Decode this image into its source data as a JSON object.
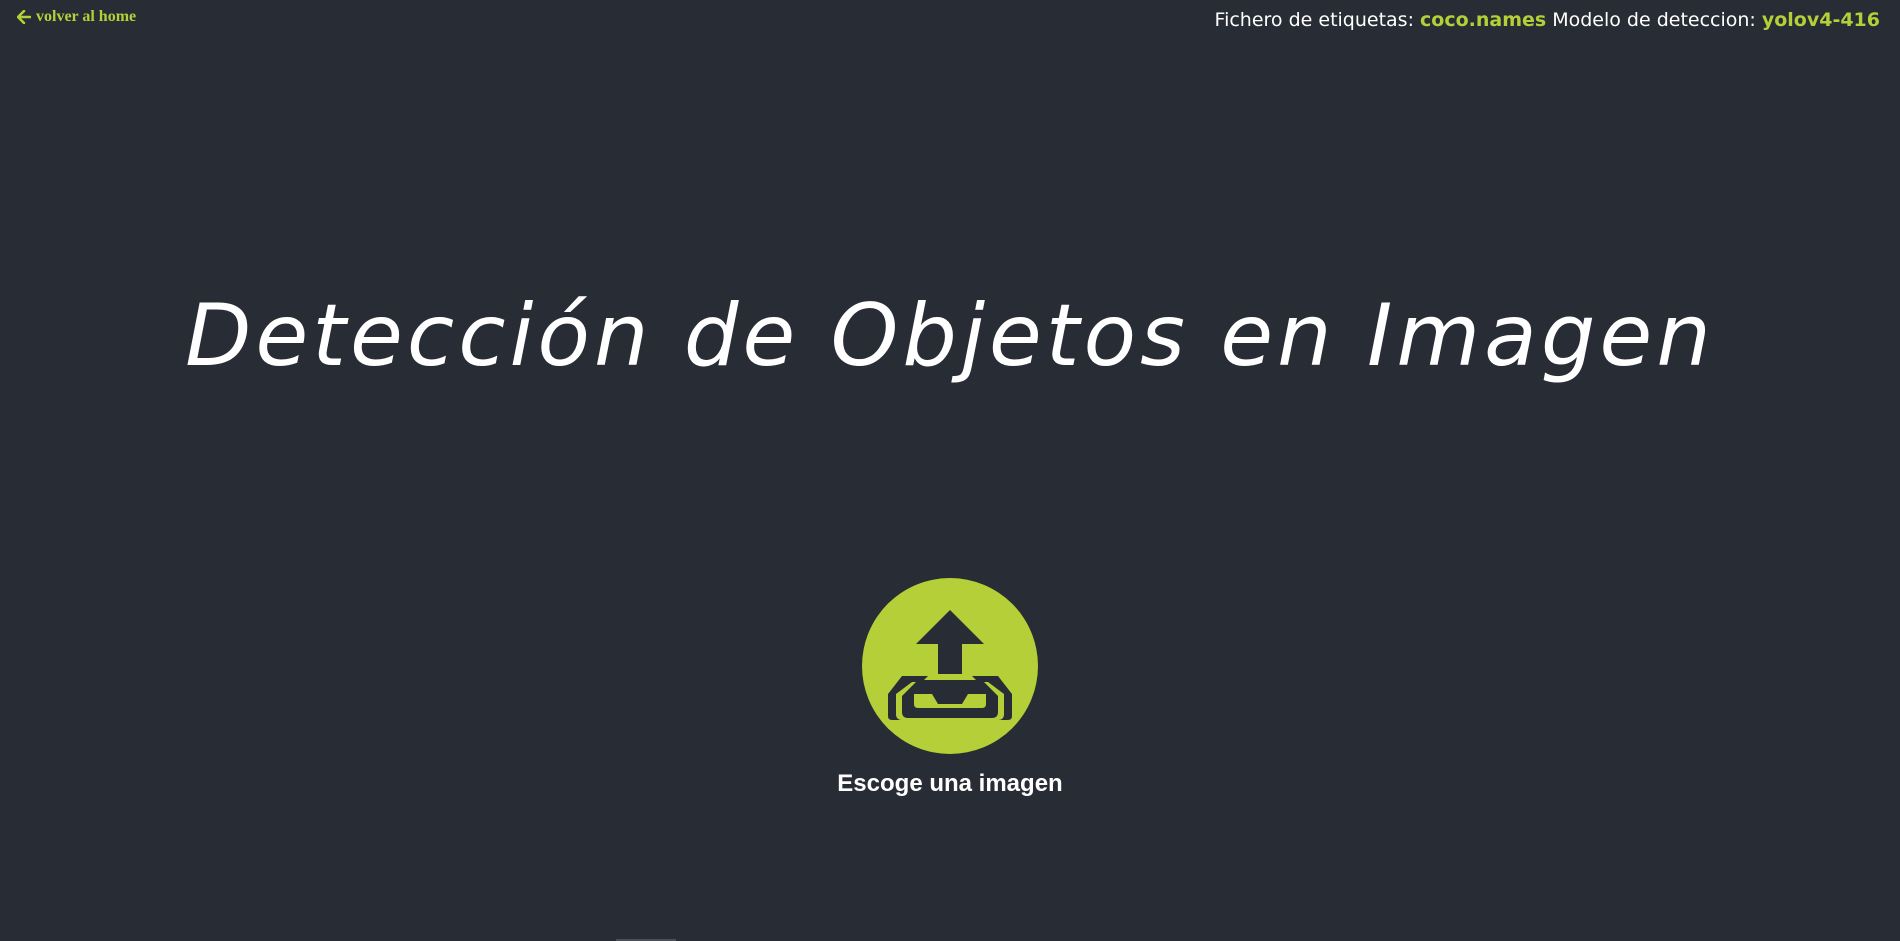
{
  "nav": {
    "back_label": "volver al home",
    "back_icon": "arrow-left-icon"
  },
  "info": {
    "labels_prefix": "Fichero de etiquetas:",
    "labels_file": "coco.names",
    "model_prefix": "Modelo de deteccion:",
    "model_name": "yolov4-416"
  },
  "main": {
    "title": "Detección de Objetos en Imagen",
    "upload_icon": "upload-tray-icon",
    "upload_label": "Escoge una imagen"
  },
  "colors": {
    "background": "#282c35",
    "accent": "#b5cf38",
    "text": "#ffffff"
  }
}
